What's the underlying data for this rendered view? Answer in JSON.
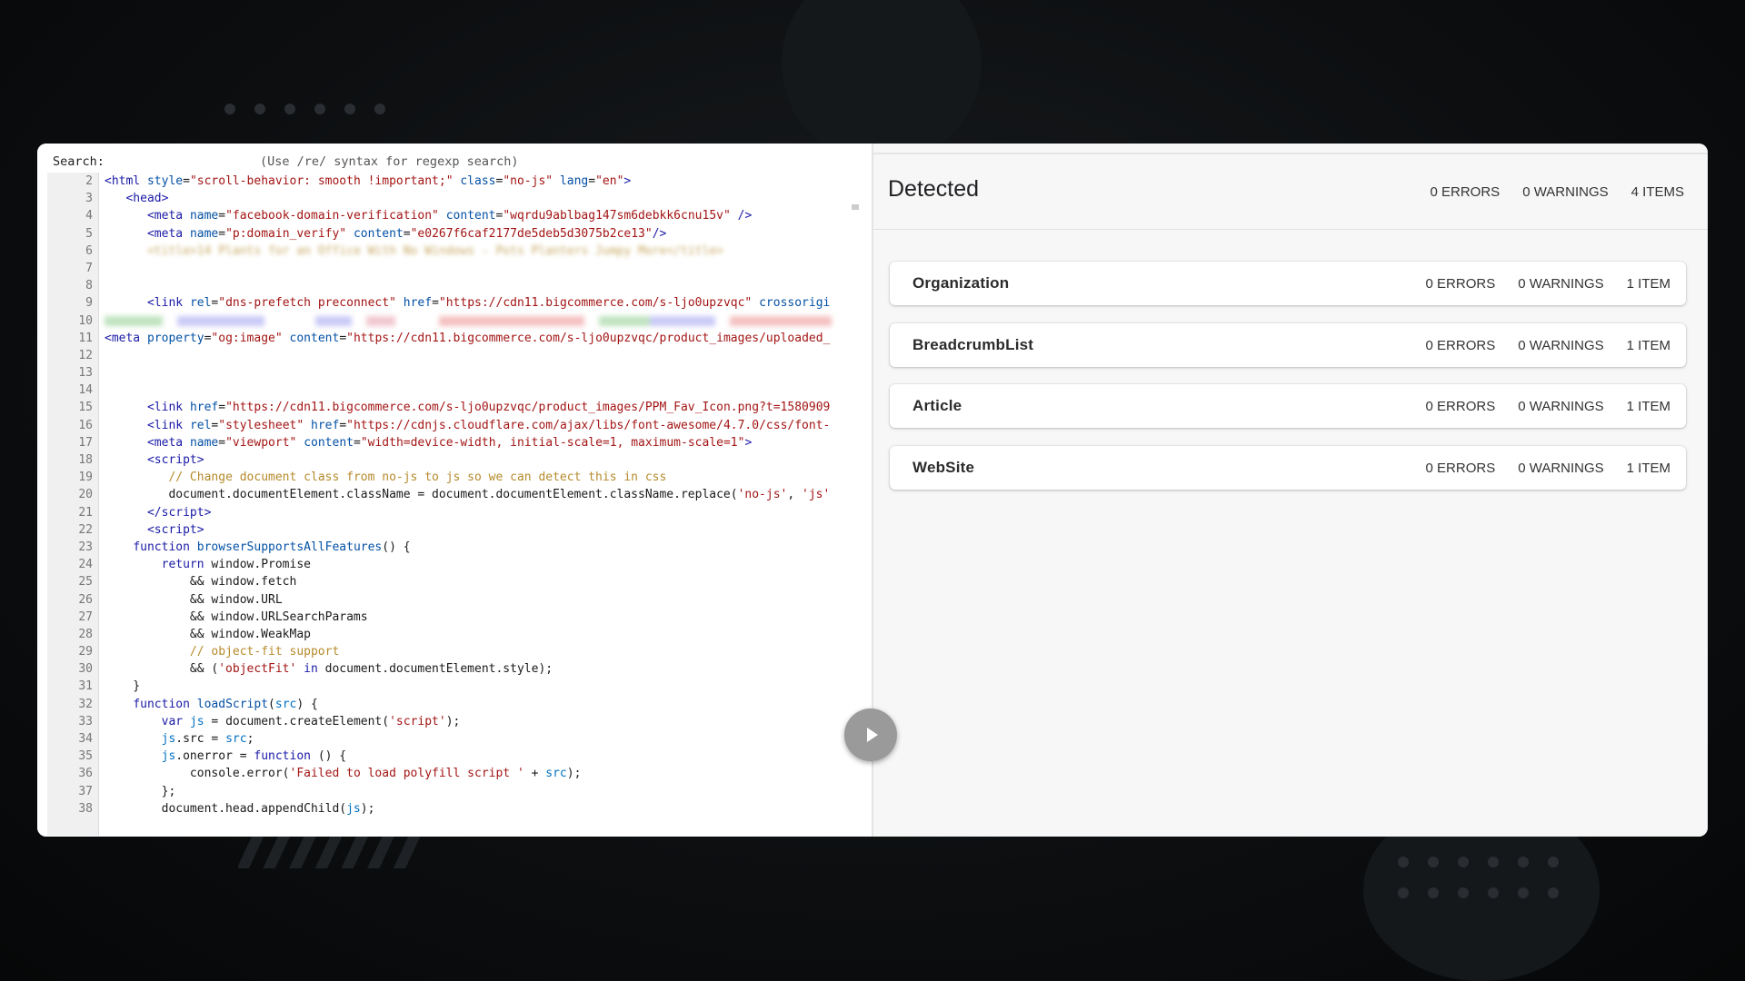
{
  "search": {
    "label": "Search:",
    "value": "",
    "hint": "(Use /re/ syntax for regexp search)"
  },
  "code": {
    "lines": [
      {
        "n": "2",
        "html": "<span class='k'>&lt;html</span> <span class='a'>style</span>=<span class='s'>\"scroll-behavior: smooth !important;\"</span> <span class='a'>class</span>=<span class='s'>\"no-js\"</span> <span class='a'>lang</span>=<span class='s'>\"en\"</span><span class='k'>&gt;</span>"
      },
      {
        "n": "3",
        "html": "   <span class='k'>&lt;head&gt;</span>"
      },
      {
        "n": "4",
        "html": "      <span class='k'>&lt;meta</span> <span class='a'>name</span>=<span class='s'>\"facebook-domain-verification\"</span> <span class='a'>content</span>=<span class='s'>\"wqrdu9ablbag147sm6debkk6cnu15v\"</span> <span class='k'>/&gt;</span>"
      },
      {
        "n": "5",
        "html": "      <span class='k'>&lt;meta</span> <span class='a'>name</span>=<span class='s'>\"p:domain_verify\"</span> <span class='a'>content</span>=<span class='s'>\"e0267f6caf2177de5deb5d3075b2ce13\"</span><span class='k'>/&gt;</span>"
      },
      {
        "n": "6",
        "html": "      <span class='blur c'>&lt;title&gt;14 Plants for an Office With No Windows - Pots Planters Jumpy More&lt;/title&gt;</span>"
      },
      {
        "n": "7",
        "html": ""
      },
      {
        "n": "8",
        "html": ""
      },
      {
        "n": "9",
        "html": "      <span class='k'>&lt;link</span> <span class='a'>rel</span>=<span class='s'>\"dns-prefetch preconnect\"</span> <span class='a'>href</span>=<span class='s'>\"https://cdn11.bigcommerce.com/s-ljo0upzvqc\"</span> <span class='a'>crossorigi</span>"
      },
      {
        "n": "10",
        "html": "",
        "blurbar": true
      },
      {
        "n": "11",
        "html": "<span class='k'>&lt;meta</span> <span class='a'>property</span>=<span class='s'>\"og:image\"</span> <span class='a'>content</span>=<span class='s'>\"https://cdn11.bigcommerce.com/s-ljo0upzvqc/product_images/uploaded_</span>"
      },
      {
        "n": "12",
        "html": ""
      },
      {
        "n": "13",
        "html": ""
      },
      {
        "n": "14",
        "html": ""
      },
      {
        "n": "15",
        "html": "      <span class='k'>&lt;link</span> <span class='a'>href</span>=<span class='s'>\"https://cdn11.bigcommerce.com/s-ljo0upzvqc/product_images/PPM_Fav_Icon.png?t=1580909</span>"
      },
      {
        "n": "16",
        "html": "      <span class='k'>&lt;link</span> <span class='a'>rel</span>=<span class='s'>\"stylesheet\"</span> <span class='a'>href</span>=<span class='s'>\"https://cdnjs.cloudflare.com/ajax/libs/font-awesome/4.7.0/css/font-</span>"
      },
      {
        "n": "17",
        "html": "      <span class='k'>&lt;meta</span> <span class='a'>name</span>=<span class='s'>\"viewport\"</span> <span class='a'>content</span>=<span class='s'>\"width=device-width, initial-scale=1, maximum-scale=1\"</span><span class='k'>&gt;</span>"
      },
      {
        "n": "18",
        "html": "      <span class='k'>&lt;script&gt;</span>"
      },
      {
        "n": "19",
        "html": "         <span class='c'>// Change document class from no-js to js so we can detect this in css</span>"
      },
      {
        "n": "20",
        "html": "         document.documentElement.className = document.documentElement.className.replace(<span class='s'>'no-js'</span>, <span class='s'>'js'</span>"
      },
      {
        "n": "21",
        "html": "      <span class='k'>&lt;/script&gt;</span>"
      },
      {
        "n": "22",
        "html": "      <span class='k'>&lt;script&gt;</span>"
      },
      {
        "n": "23",
        "html": "    <span class='k'>function</span> <span class='a'>browserSupportsAllFeatures</span>() {"
      },
      {
        "n": "24",
        "html": "        <span class='k'>return</span> window.Promise"
      },
      {
        "n": "25",
        "html": "            &amp;&amp; window.fetch"
      },
      {
        "n": "26",
        "html": "            &amp;&amp; window.URL"
      },
      {
        "n": "27",
        "html": "            &amp;&amp; window.URLSearchParams"
      },
      {
        "n": "28",
        "html": "            &amp;&amp; window.WeakMap"
      },
      {
        "n": "29",
        "html": "            <span class='c'>// object-fit support</span>"
      },
      {
        "n": "30",
        "html": "            &amp;&amp; (<span class='s'>'objectFit'</span> <span class='k'>in</span> document.documentElement.style);"
      },
      {
        "n": "31",
        "html": "    }"
      },
      {
        "n": "32",
        "html": "    <span class='k'>function</span> <span class='a'>loadScript</span>(<span class='v'>src</span>) {"
      },
      {
        "n": "33",
        "html": "        <span class='k'>var</span> <span class='v'>js</span> = document.createElement(<span class='s'>'script'</span>);"
      },
      {
        "n": "34",
        "html": "        <span class='v'>js</span>.src = <span class='v'>src</span>;"
      },
      {
        "n": "35",
        "html": "        <span class='v'>js</span>.onerror = <span class='k'>function</span> () {"
      },
      {
        "n": "36",
        "html": "            console.error(<span class='s'>'Failed to load polyfill script '</span> + <span class='v'>src</span>);"
      },
      {
        "n": "37",
        "html": "        };"
      },
      {
        "n": "38",
        "html": "        document.head.appendChild(<span class='v'>js</span>);"
      }
    ]
  },
  "results": {
    "title": "Detected",
    "errors": "0 ERRORS",
    "warnings": "0 WARNINGS",
    "items": "4 ITEMS",
    "cards": [
      {
        "name": "Organization",
        "errors": "0 ERRORS",
        "warnings": "0 WARNINGS",
        "items": "1 ITEM"
      },
      {
        "name": "BreadcrumbList",
        "errors": "0 ERRORS",
        "warnings": "0 WARNINGS",
        "items": "1 ITEM"
      },
      {
        "name": "Article",
        "errors": "0 ERRORS",
        "warnings": "0 WARNINGS",
        "items": "1 ITEM"
      },
      {
        "name": "WebSite",
        "errors": "0 ERRORS",
        "warnings": "0 WARNINGS",
        "items": "1 ITEM"
      }
    ]
  },
  "icons": {
    "play": "play-icon"
  }
}
